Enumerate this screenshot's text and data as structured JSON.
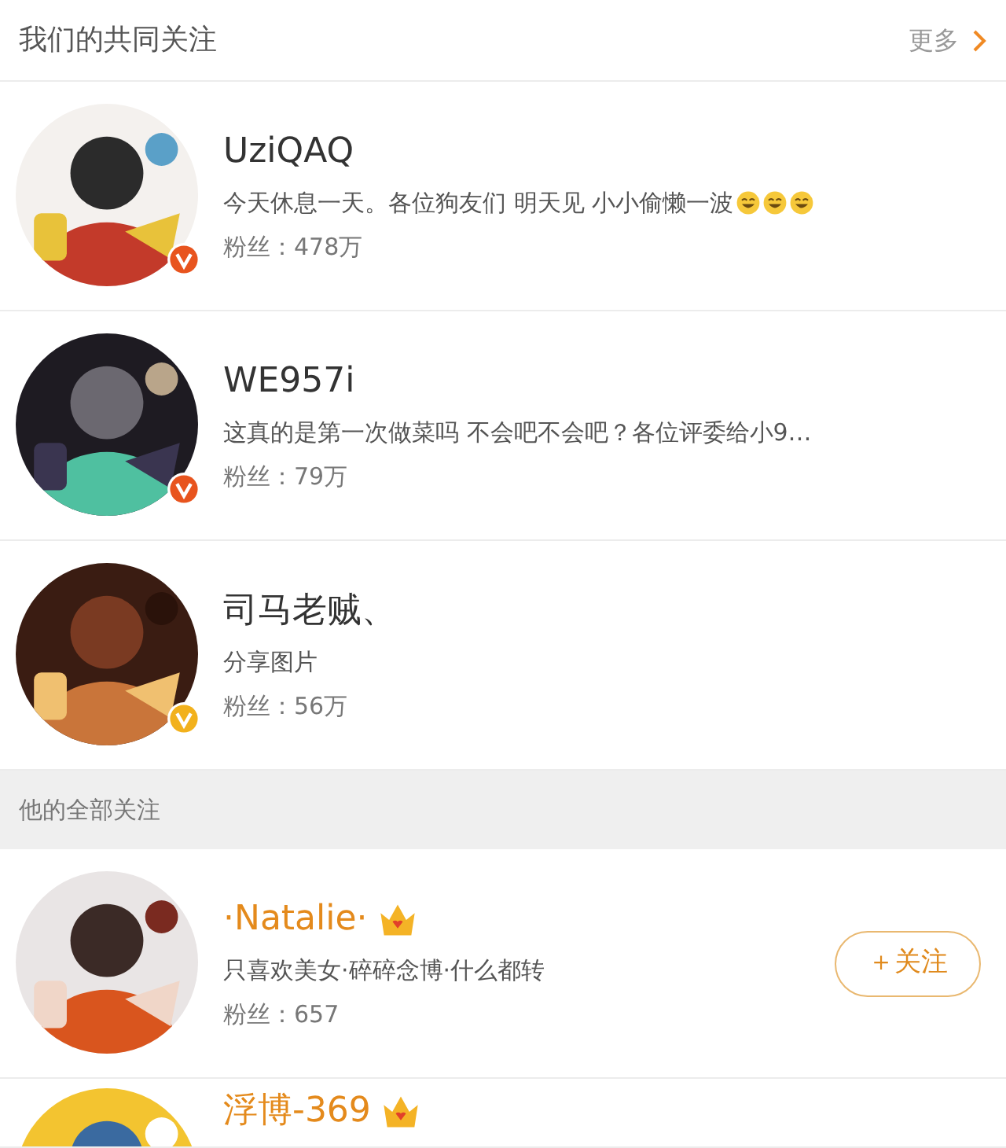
{
  "common_section": {
    "title": "我们的共同关注",
    "more": "更多"
  },
  "common_users": [
    {
      "name": "UziQAQ",
      "member": false,
      "verified": true,
      "color": "#e8541e",
      "bio": "今天休息一天。各位狗友们 明天见 小小偷懒一波",
      "emoji": [
        {
          "kind": "laugh"
        },
        {
          "kind": "laugh"
        },
        {
          "kind": "laugh"
        }
      ],
      "fans": "粉丝：478万"
    },
    {
      "name": "WE957i",
      "member": false,
      "verified": true,
      "color": "#e8541e",
      "bio": "这真的是第一次做菜吗 不会吧不会吧？各位评委给小9…",
      "fans": "粉丝：79万"
    },
    {
      "name": "司马老贼、",
      "member": false,
      "verified": true,
      "color": "#f2b11c",
      "bio": "分享图片",
      "fans": "粉丝：56万"
    }
  ],
  "all_section": {
    "title": "他的全部关注"
  },
  "all_users": [
    {
      "name": "·Natalie·",
      "member": true,
      "verified": false,
      "bio": "只喜欢美女·碎碎念博·什么都转",
      "fans": "粉丝：657",
      "follow": "＋关注"
    },
    {
      "name": "浮博-369",
      "member": true,
      "verified": false
    }
  ]
}
